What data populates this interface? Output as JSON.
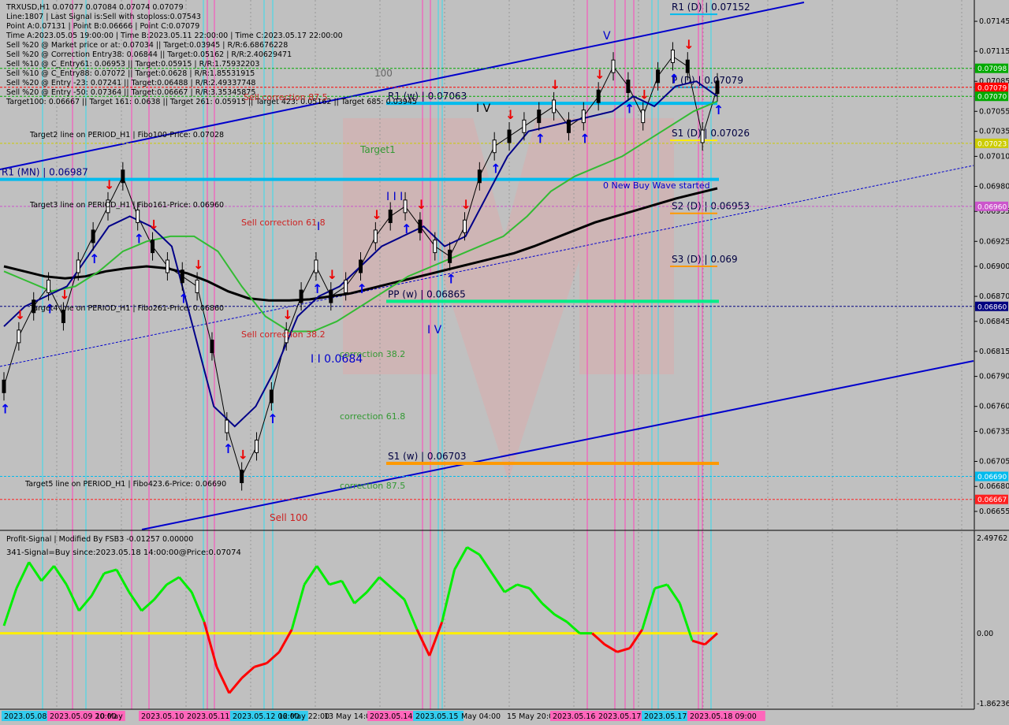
{
  "header": {
    "lines": [
      "TRXUSD,H1  0.07077 0.07084 0.07074 0.07079",
      "Line:1807 | Last Signal is:Sell with stoploss:0.07543",
      "Point A:0.07131 | Point B:0.06666 | Point C:0.07079",
      "Time A:2023.05.05 19:00:00 | Time B:2023.05.11 22:00:00 | Time C:2023.05.17 22:00:00",
      "Sell %20 @ Market price or at: 0.07034 || Target:0.03945 | R/R:6.68676228",
      "Sell %20 @ Correction Entry38: 0.06844 || Target:0.05162 | R/R:2.40629471",
      "Sell %10 @ C_Entry61: 0.06953 || Target:0.05915 | R/R:1.75932203",
      "Sell %10 @ C_Entry88: 0.07072 || Target:0.0628 | R/R:1.85531915",
      "Sell %20 @ Entry -23: 0.07241 || Target:0.06488 | R/R:2.49337748",
      "Sell %20 @ Entry -50: 0.07364 || Target:0.06667 | R/R:3.35345875",
      "Target100: 0.06667 || Target 161: 0.0638 || Target 261: 0.05915 || Target 423: 0.05162 || Target 685: 0.03945"
    ]
  },
  "chart_data": {
    "type": "line",
    "symbol": "TRXUSD",
    "timeframe": "H1",
    "ohlc_last": {
      "open": 0.07077,
      "high": 0.07084,
      "low": 0.07074,
      "close": 0.07079
    },
    "ylim": [
      0.0664,
      0.0716
    ],
    "y_ticks": [
      "0.07145",
      "0.07115",
      "0.07085",
      "0.07055",
      "0.07035",
      "0.07010",
      "0.06980",
      "0.06955",
      "0.06925",
      "0.06900",
      "0.06870",
      "0.06845",
      "0.06815",
      "0.06790",
      "0.06760",
      "0.06735",
      "0.06705",
      "0.06680",
      "0.06655"
    ],
    "price_tags": [
      {
        "label": "0.07098",
        "value": 0.07098,
        "bg": "#00aa00",
        "fg": "#ffffff"
      },
      {
        "label": "0.07079",
        "value": 0.07079,
        "bg": "#ff0000",
        "fg": "#ffffff"
      },
      {
        "label": "0.07070",
        "value": 0.0707,
        "bg": "#00aa00",
        "fg": "#ffffff"
      },
      {
        "label": "0.07023",
        "value": 0.07023,
        "bg": "#cccc00",
        "fg": "#ffffff"
      },
      {
        "label": "0.06960",
        "value": 0.0696,
        "bg": "#cc55cc",
        "fg": "#ffffff"
      },
      {
        "label": "0.06860",
        "value": 0.0686,
        "bg": "#000080",
        "fg": "#ffffff"
      },
      {
        "label": "0.06690",
        "value": 0.0669,
        "bg": "#00bbee",
        "fg": "#ffffff"
      },
      {
        "label": "0.06667",
        "value": 0.06667,
        "bg": "#ff2020",
        "fg": "#ffffff"
      }
    ],
    "x_labels": [
      "2023.05.08",
      "2023.05.09 20:00",
      "10 May",
      "2023.05.10 20:00",
      "2023.05.11 14:00",
      "2023.05.12 06:00",
      "12 May 22:00",
      "13 May 14:00",
      "2023.05.14",
      "2023.05.15",
      "May 04:00",
      "15 May 20:00",
      "2023.05.16",
      "2023.05.17",
      "2023.05.17",
      "2023.05.18 09:00"
    ],
    "levels": [
      {
        "label": "R1 (D) | 0.07152",
        "value": 0.07152,
        "color": "#00bbee"
      },
      {
        "label": "P (D) | 0.07079",
        "value": 0.07079,
        "color": "#00bbee"
      },
      {
        "label": "R1 (w) | 0.07063",
        "value": 0.07063,
        "color": "#00bbee"
      },
      {
        "label": "S1 (D) | 0.07026",
        "value": 0.07026,
        "color": "#ffee00"
      },
      {
        "label": "R1 (MN) | 0.06987",
        "value": 0.06987,
        "color": "#00bbee"
      },
      {
        "label": "S2 (D) | 0.06953",
        "value": 0.06953,
        "color": "#ff9900"
      },
      {
        "label": "S3 (D) | 0.069",
        "value": 0.069,
        "color": "#ff9900"
      },
      {
        "label": "PP (w) | 0.06865",
        "value": 0.06865,
        "color": "#00ee88"
      },
      {
        "label": "S1 (w) | 0.06703",
        "value": 0.06703,
        "color": "#ff9900"
      }
    ],
    "annotations": [
      "Target2 line on PERIOD_H1 | Fibo100-Price: 0.07028",
      "Target3 line on PERIOD_H1 | Fibo161-Price: 0.06960",
      "Target4 line on PERIOD_H1 | Fibo261-Price: 0.06860",
      "Target5 line on PERIOD_H1 | Fibo423.6-Price: 0.06690",
      "Target1",
      "100",
      "Sell correction 87.5",
      "Sell correction 61.8",
      "Sell correction 38.2",
      "correction 38.2",
      "correction 61.8",
      "correction 87.5",
      "Sell 100",
      "0 New Buy Wave started",
      "I I I",
      "I V",
      "I I 0.0684",
      "V",
      "I V",
      "I"
    ],
    "series": [
      {
        "name": "price",
        "color": "#000000",
        "values": [
          0.0678,
          0.0683,
          0.0686,
          0.0688,
          0.0685,
          0.069,
          0.0693,
          0.0696,
          0.0699,
          0.0695,
          0.0692,
          0.069,
          0.0689,
          0.0688,
          0.0682,
          0.0674,
          0.0669,
          0.0672,
          0.0677,
          0.0683,
          0.0687,
          0.069,
          0.0687,
          0.0688,
          0.069,
          0.0693,
          0.0695,
          0.0696,
          0.0694,
          0.0692,
          0.0691,
          0.0694,
          0.0699,
          0.0702,
          0.0703,
          0.0704,
          0.0705,
          0.0706,
          0.0704,
          0.0705,
          0.0707,
          0.071,
          0.0708,
          0.0705,
          0.0709,
          0.0711,
          0.071,
          0.0703,
          0.07079
        ]
      },
      {
        "name": "ma_slow",
        "color": "#000000",
        "values": [
          0.069,
          0.06895,
          0.0689,
          0.06888,
          0.0689,
          0.06895,
          0.06898,
          0.069,
          0.06898,
          0.06893,
          0.06885,
          0.06875,
          0.06868,
          0.06866,
          0.06866,
          0.06867,
          0.0687,
          0.06873,
          0.06878,
          0.06883,
          0.06888,
          0.06893,
          0.06898,
          0.06903,
          0.06908,
          0.06913,
          0.0692,
          0.06928,
          0.06936,
          0.06944,
          0.0695,
          0.06956,
          0.06962,
          0.06968,
          0.06973,
          0.06978
        ]
      },
      {
        "name": "ma_mid",
        "color": "#33bb33",
        "values": [
          0.06895,
          0.06885,
          0.06875,
          0.0688,
          0.06895,
          0.06915,
          0.06925,
          0.0693,
          0.0693,
          0.06915,
          0.0688,
          0.0685,
          0.06835,
          0.06835,
          0.06845,
          0.0686,
          0.06875,
          0.0689,
          0.069,
          0.0691,
          0.0692,
          0.0693,
          0.0695,
          0.06975,
          0.0699,
          0.07,
          0.0701,
          0.07025,
          0.0704,
          0.07055,
          0.07065
        ]
      },
      {
        "name": "ma_fast",
        "color": "#000088",
        "values": [
          0.0684,
          0.0686,
          0.0687,
          0.0688,
          0.0691,
          0.0694,
          0.0695,
          0.0694,
          0.0692,
          0.0684,
          0.0676,
          0.0674,
          0.0676,
          0.068,
          0.0685,
          0.0687,
          0.0688,
          0.069,
          0.0692,
          0.0693,
          0.0694,
          0.0692,
          0.0693,
          0.0697,
          0.0701,
          0.07035,
          0.0704,
          0.07045,
          0.0705,
          0.07055,
          0.0707,
          0.0706,
          0.0708,
          0.07085,
          0.0707
        ]
      }
    ]
  },
  "indicator": {
    "title": "Profit-Signal | Modified By FSB3 -0.01257 0.00000",
    "signal": "341-Signal=Buy since:2023.05.18 14:00:00@Price:0.07074",
    "y_ticks": [
      "2.49762",
      "0.00",
      "-1.86236"
    ],
    "ylim": [
      -1.86236,
      2.49762
    ],
    "osc_values": [
      0.2,
      1.2,
      1.9,
      1.4,
      1.8,
      1.3,
      0.6,
      1.0,
      1.6,
      1.7,
      1.1,
      0.6,
      0.9,
      1.3,
      1.5,
      1.1,
      0.3,
      -0.9,
      -1.6,
      -1.2,
      -0.9,
      -0.8,
      -0.5,
      0.1,
      1.3,
      1.8,
      1.3,
      1.4,
      0.8,
      1.1,
      1.5,
      1.2,
      0.9,
      0.1,
      -0.6,
      0.3,
      1.7,
      2.3,
      2.1,
      1.6,
      1.1,
      1.3,
      1.2,
      0.8,
      0.5,
      0.3,
      0.0,
      0.0,
      -0.3,
      -0.5,
      -0.4,
      0.1,
      1.2,
      1.3,
      0.8,
      -0.2,
      -0.3,
      0.0
    ]
  },
  "colors": {
    "background": "#c0c0c0",
    "up_line": "#00ee00",
    "down_line": "#ff0000",
    "zero_line": "#ffee00",
    "channel": "#0000cc",
    "pivot": "#00bbee"
  }
}
